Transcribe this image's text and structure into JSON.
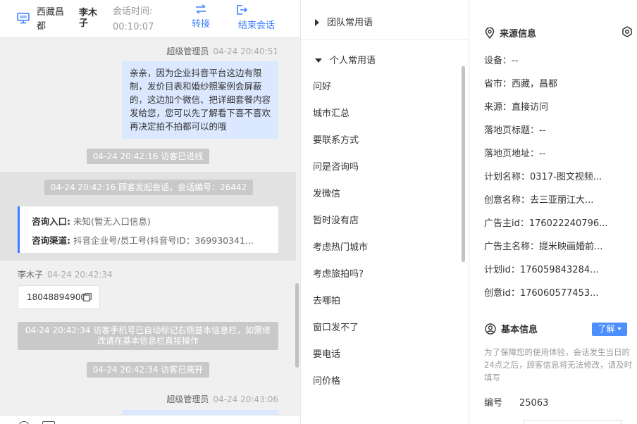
{
  "header": {
    "location": "西藏昌都",
    "visitor": "李木子",
    "time_label": "会话时间:",
    "time_value": "00:10:07",
    "transfer_label": "转接",
    "end_label": "结束会话"
  },
  "messages": {
    "admin1": {
      "sender": "超级管理员",
      "time": "04-24 20:40:51",
      "text": "亲亲，因为企业抖音平台这边有限制，发价目表和婚纱照案例会屏蔽的，这边加个微信、把详细套餐内容发给您，您可以先了解看下喜不喜欢再决定拍不拍都可以的哦"
    },
    "sys_entered": "04-24 20:42:16 访客已进线",
    "sys_started": "04-24 20:42:16 顾客发起会话，会话编号：26442",
    "card": {
      "entry_label": "咨询入口:",
      "entry_value": "未知(暂无入口信息)",
      "channel_label": "咨询渠道:",
      "channel_value": "抖音企业号/员工号(抖音号ID：369930341..."
    },
    "visitor1": {
      "sender": "李木子",
      "time": "04-24 20:42:34",
      "phone": "18048894900"
    },
    "sys_phone_note": "04-24 20:42:34 访客手机号已自动标记右侧基本信息栏，如需修改请在基本信息栏直接操作",
    "sys_left": "04-24 20:42:34 访客已离开",
    "admin2": {
      "sender": "超级管理员",
      "time": "04-24 20:43:06"
    }
  },
  "phrases": {
    "team_group": "团队常用语",
    "personal_group": "个人常用语",
    "items": [
      "问好",
      "城市汇总",
      "要联系方式",
      "问是咨询吗",
      "发微信",
      "暂时没有店",
      "考虑热门城市",
      "考虑旅拍吗?",
      "去哪拍",
      "窗口发不了",
      "要电话",
      "问价格"
    ]
  },
  "source_info": {
    "title": "来源信息",
    "fields": [
      "设备：--",
      "省市：西藏，昌都",
      "来源：直接访问",
      "落地页标题：--",
      "落地页地址：--",
      "计划名称：0317-图文视频...",
      "创意名称：去三亚丽江大...",
      "广告主id：176022240796...",
      "广告主名称：提米映画婚前...",
      "计划id：176059843284...",
      "创意id：176060577453..."
    ]
  },
  "basic_info": {
    "title": "基本信息",
    "learn_label": "了解",
    "note": "为了保障您的使用体验，会话发生当日的24点之后，顾客信息将无法修改，请及时填写",
    "id_label": "编号",
    "id_value": "25063"
  },
  "colors": {
    "accent": "#3d7fff",
    "admin_bubble": "#dbe8ff",
    "system_pill": "#c9c9c9"
  }
}
